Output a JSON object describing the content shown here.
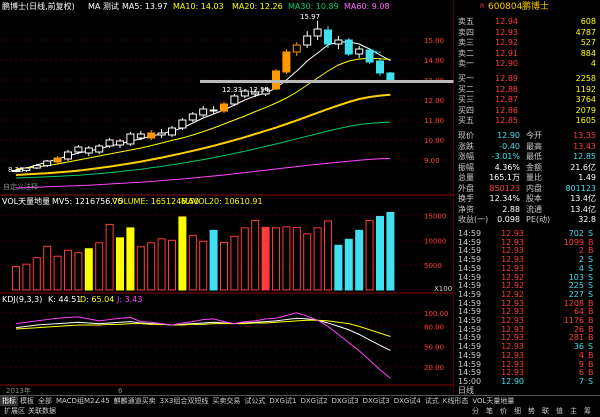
{
  "colors": {
    "up": "#ff3b3b",
    "down": "#40e0f0",
    "flat": "#ffffff",
    "yellow": "#ffff00",
    "orange": "#ff9900",
    "gold": "#ffcc00",
    "white": "#ffffff",
    "grid": "#8b0000"
  },
  "main_chart": {
    "legend": {
      "title": "鹏博士(日线,前复权)",
      "ma_label": "MA 测试",
      "ma5": "MA5: 13.97",
      "ma10": "MA10: 14.03",
      "ma20": "MA20: 12.26",
      "ma30": "MA30: 10.89",
      "ma60": "MA60: 9.08"
    },
    "annotations": {
      "high": "15.97",
      "low_left": "8.38",
      "range": "12.33 - 12.54",
      "marker": "←",
      "note": "自定义注释"
    },
    "y_ticks": [
      "15.00",
      "14.00",
      "13.00",
      "12.00",
      "11.00",
      "10.00",
      "9.00"
    ],
    "y_values": [
      15,
      14,
      13,
      12,
      11,
      10,
      9
    ],
    "candles": [
      [
        8.45,
        8.48,
        8.38,
        8.55,
        "w"
      ],
      [
        8.48,
        8.6,
        8.4,
        8.65,
        "w"
      ],
      [
        8.6,
        8.72,
        8.55,
        8.8,
        "w"
      ],
      [
        8.72,
        8.95,
        8.65,
        9.0,
        "w"
      ],
      [
        8.9,
        9.1,
        8.8,
        9.2,
        "w"
      ],
      [
        9.05,
        9.4,
        8.95,
        9.5,
        "w"
      ],
      [
        9.4,
        9.65,
        9.3,
        9.75,
        "w"
      ],
      [
        9.6,
        9.35,
        9.2,
        9.7,
        "w"
      ],
      [
        9.4,
        9.7,
        9.3,
        9.8,
        "w"
      ],
      [
        9.7,
        10.0,
        9.6,
        10.1,
        "w"
      ],
      [
        9.95,
        9.75,
        9.6,
        10.05,
        "w"
      ],
      [
        9.8,
        10.3,
        9.7,
        10.4,
        "w"
      ],
      [
        10.3,
        10.1,
        10.0,
        10.45,
        "w"
      ],
      [
        10.1,
        10.35,
        10.0,
        10.5,
        "w"
      ],
      [
        10.35,
        10.25,
        10.1,
        10.55,
        "w"
      ],
      [
        10.25,
        10.6,
        10.15,
        10.7,
        "w"
      ],
      [
        10.6,
        11.0,
        10.5,
        11.1,
        "w"
      ],
      [
        11.0,
        11.3,
        10.9,
        11.4,
        "w"
      ],
      [
        11.25,
        11.55,
        11.15,
        11.7,
        "w"
      ],
      [
        11.5,
        11.45,
        11.3,
        11.7,
        "w"
      ],
      [
        11.45,
        11.8,
        11.35,
        11.9,
        "w"
      ],
      [
        11.8,
        12.2,
        11.7,
        12.3,
        "w"
      ],
      [
        12.2,
        12.45,
        12.1,
        12.55,
        "w"
      ],
      [
        12.4,
        12.3,
        12.15,
        12.55,
        "w"
      ],
      [
        12.3,
        12.55,
        12.2,
        12.65,
        "w"
      ],
      [
        12.55,
        13.45,
        12.5,
        13.55,
        "w"
      ],
      [
        13.4,
        14.4,
        13.3,
        14.55,
        "w"
      ],
      [
        14.4,
        14.75,
        14.2,
        14.9,
        "w"
      ],
      [
        14.75,
        15.2,
        14.6,
        15.45,
        "w"
      ],
      [
        15.2,
        15.55,
        15.0,
        15.97,
        "w"
      ],
      [
        15.5,
        14.8,
        14.6,
        15.7,
        "c"
      ],
      [
        14.8,
        15.0,
        14.55,
        15.2,
        "w"
      ],
      [
        15.0,
        14.3,
        14.2,
        15.1,
        "c"
      ],
      [
        14.3,
        14.55,
        14.1,
        14.7,
        "w"
      ],
      [
        14.5,
        13.9,
        13.8,
        14.6,
        "c"
      ],
      [
        13.95,
        13.35,
        13.2,
        14.1,
        "c"
      ],
      [
        13.35,
        12.95,
        12.85,
        13.4,
        "c"
      ]
    ],
    "ma_lines": {
      "ma5": [
        8.5,
        8.6,
        8.75,
        8.9,
        9.05,
        9.2,
        9.35,
        9.45,
        9.55,
        9.7,
        9.8,
        9.95,
        10.05,
        10.2,
        10.3,
        10.45,
        10.6,
        10.85,
        11.1,
        11.3,
        11.5,
        11.75,
        12.0,
        12.2,
        12.35,
        12.6,
        13.0,
        13.45,
        13.95,
        14.35,
        14.75,
        14.9,
        14.9,
        14.8,
        14.55,
        14.25,
        13.97
      ],
      "ma10": [
        8.55,
        8.6,
        8.65,
        8.72,
        8.8,
        8.9,
        9.0,
        9.1,
        9.2,
        9.3,
        9.4,
        9.5,
        9.6,
        9.72,
        9.85,
        9.98,
        10.1,
        10.25,
        10.42,
        10.6,
        10.8,
        11.0,
        11.2,
        11.42,
        11.62,
        11.85,
        12.1,
        12.4,
        12.75,
        13.1,
        13.45,
        13.75,
        13.95,
        14.05,
        14.08,
        14.06,
        14.03
      ],
      "ma20": [
        8.25,
        8.28,
        8.31,
        8.34,
        8.38,
        8.42,
        8.47,
        8.53,
        8.6,
        8.67,
        8.75,
        8.83,
        8.92,
        9.02,
        9.12,
        9.23,
        9.34,
        9.46,
        9.58,
        9.71,
        9.85,
        9.99,
        10.14,
        10.3,
        10.46,
        10.62,
        10.8,
        10.98,
        11.17,
        11.36,
        11.55,
        11.73,
        11.9,
        12.05,
        12.15,
        12.22,
        12.26
      ],
      "ma30": [
        8.1,
        8.12,
        8.14,
        8.16,
        8.18,
        8.21,
        8.24,
        8.28,
        8.32,
        8.37,
        8.42,
        8.48,
        8.54,
        8.61,
        8.68,
        8.76,
        8.84,
        8.93,
        9.02,
        9.12,
        9.22,
        9.33,
        9.44,
        9.56,
        9.68,
        9.8,
        9.93,
        10.06,
        10.19,
        10.32,
        10.45,
        10.57,
        10.68,
        10.77,
        10.83,
        10.87,
        10.89
      ],
      "ma60": [
        7.6,
        7.62,
        7.64,
        7.66,
        7.68,
        7.7,
        7.72,
        7.74,
        7.77,
        7.8,
        7.83,
        7.86,
        7.89,
        7.93,
        7.97,
        8.01,
        8.05,
        8.1,
        8.15,
        8.2,
        8.25,
        8.31,
        8.37,
        8.43,
        8.49,
        8.55,
        8.61,
        8.67,
        8.73,
        8.79,
        8.84,
        8.89,
        8.94,
        8.99,
        9.03,
        9.06,
        9.08
      ]
    }
  },
  "volume_chart": {
    "legend": {
      "label": "VOL天量地量",
      "mv5": "MV5: 1216756.75",
      "volume": "VOLUME: 1651246.50",
      "mavol20": "MAVOL20: 10610.91"
    },
    "y_ticks": [
      "15000",
      "10000",
      "5000"
    ],
    "y_values": [
      15000,
      10000,
      5000
    ],
    "unit": "X100",
    "bars": [
      [
        4700,
        "w"
      ],
      [
        5200,
        "w"
      ],
      [
        6500,
        "w"
      ],
      [
        8800,
        "w"
      ],
      [
        6800,
        "w"
      ],
      [
        8000,
        "w"
      ],
      [
        7500,
        "w"
      ],
      [
        8300,
        "y"
      ],
      [
        9500,
        "w"
      ],
      [
        13200,
        "w"
      ],
      [
        10500,
        "y"
      ],
      [
        12500,
        "y"
      ],
      [
        8700,
        "w"
      ],
      [
        9500,
        "w"
      ],
      [
        10300,
        "w"
      ],
      [
        10000,
        "w"
      ],
      [
        14700,
        "y"
      ],
      [
        11000,
        "w"
      ],
      [
        9800,
        "w"
      ],
      [
        12000,
        "c"
      ],
      [
        9600,
        "w"
      ],
      [
        10800,
        "w"
      ],
      [
        12500,
        "w"
      ],
      [
        14000,
        "w"
      ],
      [
        12600,
        "r"
      ],
      [
        12500,
        "w"
      ],
      [
        12700,
        "w"
      ],
      [
        12600,
        "w"
      ],
      [
        11300,
        "w"
      ],
      [
        12500,
        "w"
      ],
      [
        13900,
        "w"
      ],
      [
        9000,
        "c"
      ],
      [
        10200,
        "c"
      ],
      [
        12000,
        "c"
      ],
      [
        14000,
        "w"
      ],
      [
        14800,
        "c"
      ],
      [
        15600,
        "c"
      ]
    ]
  },
  "kdj_chart": {
    "legend": {
      "label": "KDJ(9,3,3)",
      "k": "K: 44.51",
      "d": "D: 65.04",
      "j": "J: 3.43"
    },
    "y_ticks": [
      "100.00",
      "80.00",
      "50.00",
      "20.00"
    ],
    "y_values": [
      100,
      80,
      50,
      20
    ],
    "k": [
      78,
      80,
      82,
      83,
      84,
      85,
      86,
      85,
      84,
      85,
      86,
      87,
      85,
      84,
      83,
      82,
      83,
      84,
      85,
      86,
      85,
      84,
      85,
      86,
      87,
      88,
      90,
      92,
      91,
      89,
      85,
      80,
      75,
      68,
      60,
      52,
      44.51
    ],
    "d": [
      76,
      77,
      78,
      79,
      80,
      81,
      82,
      82,
      82,
      83,
      83,
      84,
      84,
      83,
      83,
      82,
      82,
      83,
      83,
      84,
      84,
      84,
      84,
      85,
      85,
      86,
      87,
      88,
      89,
      89,
      88,
      86,
      84,
      80,
      75,
      70,
      65.04
    ],
    "j": [
      84,
      86,
      88,
      90,
      92,
      93,
      94,
      91,
      88,
      90,
      92,
      93,
      87,
      86,
      84,
      82,
      85,
      87,
      90,
      91,
      87,
      84,
      87,
      88,
      91,
      92,
      96,
      100,
      95,
      89,
      80,
      68,
      56,
      44,
      30,
      16,
      3.43
    ]
  },
  "x_axis": {
    "year": "2013年",
    "month": "6"
  },
  "quote_panel": {
    "code": "600804",
    "name": "鹏博士",
    "r_badge": "R",
    "sell": [
      {
        "label": "卖五",
        "price": "12.94",
        "vol": "608"
      },
      {
        "label": "卖四",
        "price": "12.93",
        "vol": "4787"
      },
      {
        "label": "卖三",
        "price": "12.92",
        "vol": "527"
      },
      {
        "label": "卖二",
        "price": "12.91",
        "vol": "884"
      },
      {
        "label": "卖一",
        "price": "12.90",
        "vol": "4"
      }
    ],
    "buy": [
      {
        "label": "买一",
        "price": "12.89",
        "vol": "2258"
      },
      {
        "label": "买二",
        "price": "12.88",
        "vol": "1192"
      },
      {
        "label": "买三",
        "price": "12.87",
        "vol": "3764"
      },
      {
        "label": "买四",
        "price": "12.86",
        "vol": "2079"
      },
      {
        "label": "买五",
        "price": "12.85",
        "vol": "1605"
      }
    ],
    "stats": [
      {
        "l1": "现价",
        "v1": "12.90",
        "c1": "c",
        "l2": "今开",
        "v2": "13.35",
        "c2": "r"
      },
      {
        "l1": "涨跌",
        "v1": "-0.40",
        "c1": "c",
        "l2": "最高",
        "v2": "13.43",
        "c2": "r"
      },
      {
        "l1": "涨幅",
        "v1": "-3.01%",
        "c1": "c",
        "l2": "最低",
        "v2": "12.85",
        "c2": "c"
      },
      {
        "l1": "振幅",
        "v1": "4.36%",
        "c1": "w",
        "l2": "金额",
        "v2": "21.6亿",
        "c2": "w"
      },
      {
        "l1": "总量",
        "v1": "165.1万",
        "c1": "w",
        "l2": "量比",
        "v2": "1.49",
        "c2": "w"
      },
      {
        "l1": "外盘",
        "v1": "850123",
        "c1": "r",
        "l2": "内盘",
        "v2": "801123",
        "c2": "c"
      },
      {
        "l1": "换手",
        "v1": "12.34%",
        "c1": "w",
        "l2": "股本",
        "v2": "13.4亿",
        "c2": "w"
      },
      {
        "l1": "净资",
        "v1": "2.88",
        "c1": "w",
        "l2": "流通",
        "v2": "13.4亿",
        "c2": "w"
      },
      {
        "l1": "收益(一)",
        "v1": "0.098",
        "c1": "w",
        "l2": "PE(动)",
        "v2": "32.8",
        "c2": "w"
      }
    ],
    "ticks": [
      {
        "time": "14:59",
        "price": "12.93",
        "vol": "702",
        "dir": "S",
        "pc": "r",
        "vc": "c"
      },
      {
        "time": "14:59",
        "price": "12.93",
        "vol": "1099",
        "dir": "B",
        "pc": "r",
        "vc": "r"
      },
      {
        "time": "14:59",
        "price": "12.93",
        "vol": "2",
        "dir": "B",
        "pc": "r",
        "vc": "r"
      },
      {
        "time": "14:59",
        "price": "12.93",
        "vol": "2",
        "dir": "S",
        "pc": "r",
        "vc": "c"
      },
      {
        "time": "14:59",
        "price": "12.93",
        "vol": "4",
        "dir": "S",
        "pc": "r",
        "vc": "c"
      },
      {
        "time": "14:59",
        "price": "12.92",
        "vol": "103",
        "dir": "S",
        "pc": "r",
        "vc": "c"
      },
      {
        "time": "14:59",
        "price": "12.92",
        "vol": "225",
        "dir": "S",
        "pc": "r",
        "vc": "c"
      },
      {
        "time": "14:59",
        "price": "12.92",
        "vol": "227",
        "dir": "S",
        "pc": "r",
        "vc": "c"
      },
      {
        "time": "14:59",
        "price": "12.93",
        "vol": "1208",
        "dir": "B",
        "pc": "r",
        "vc": "r"
      },
      {
        "time": "14:59",
        "price": "12.93",
        "vol": "64",
        "dir": "B",
        "pc": "r",
        "vc": "r"
      },
      {
        "time": "14:59",
        "price": "12.93",
        "vol": "1176",
        "dir": "B",
        "pc": "r",
        "vc": "r"
      },
      {
        "time": "14:59",
        "price": "12.93",
        "vol": "26",
        "dir": "B",
        "pc": "r",
        "vc": "r"
      },
      {
        "time": "14:59",
        "price": "12.93",
        "vol": "281",
        "dir": "B",
        "pc": "r",
        "vc": "r"
      },
      {
        "time": "14:59",
        "price": "12.93",
        "vol": "36",
        "dir": "S",
        "pc": "r",
        "vc": "c"
      },
      {
        "time": "14:59",
        "price": "12.93",
        "vol": "4",
        "dir": "B",
        "pc": "r",
        "vc": "r"
      },
      {
        "time": "14:59",
        "price": "12.93",
        "vol": "9",
        "dir": "B",
        "pc": "r",
        "vc": "r"
      },
      {
        "time": "14:59",
        "price": "12.93",
        "vol": "6",
        "dir": "B",
        "pc": "r",
        "vc": "r"
      },
      {
        "time": "15:00",
        "price": "12.90",
        "vol": "7",
        "dir": "S",
        "pc": "c",
        "vc": "c"
      }
    ],
    "daily_label": "日线"
  },
  "tabs": [
    "指标",
    "模板",
    "全部",
    "MACD组M2∠45",
    "麒麟通道买卖",
    "3X3组合双短线",
    "买卖交易",
    "试公式",
    "DXG试1",
    "DXG试2",
    "DXG试3",
    "DXG试3",
    "DXG试4",
    "试式",
    "K线形态",
    "VOL天量地量"
  ],
  "status_bar": {
    "left1": "扩展区",
    "left2": "关联数据",
    "right1": "分",
    "right2": "笔",
    "right3": "价",
    "right4": "细",
    "right5": "势",
    "right6": "联",
    "right7": "值",
    "right8": "主",
    "right9": "筹"
  }
}
